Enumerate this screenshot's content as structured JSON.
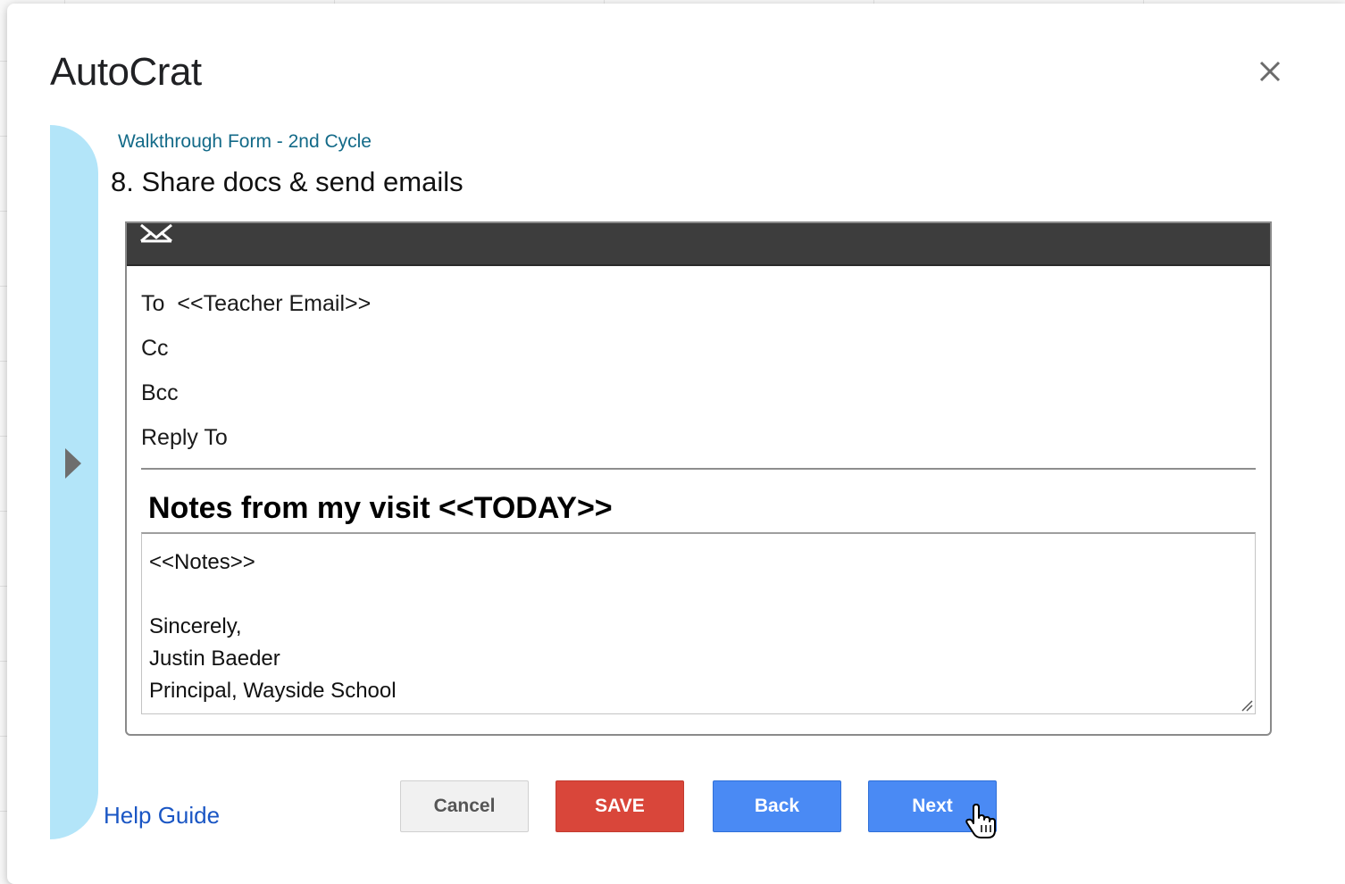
{
  "dialog": {
    "title": "AutoCrat",
    "close_icon": "close-icon"
  },
  "breadcrumb": "Walkthrough Form - 2nd Cycle",
  "step_title": "8. Share docs & send emails",
  "email": {
    "header_icon": "mail-icon",
    "to_label": "To",
    "to_value": "<<Teacher Email>>",
    "cc_label": "Cc",
    "bcc_label": "Bcc",
    "reply_to_label": "Reply To",
    "subject": "Notes from my visit <<TODAY>>",
    "body_lines": [
      "<<Notes>>",
      "",
      "Sincerely,",
      "Justin Baeder",
      "Principal, Wayside School"
    ]
  },
  "help_link": "Help Guide",
  "buttons": {
    "cancel": "Cancel",
    "save": "SAVE",
    "back": "Back",
    "next": "Next"
  },
  "colors": {
    "rail": "#b3e5f9",
    "save": "#d9463a",
    "primary": "#4a8af4",
    "header_bar": "#3d3d3d"
  }
}
